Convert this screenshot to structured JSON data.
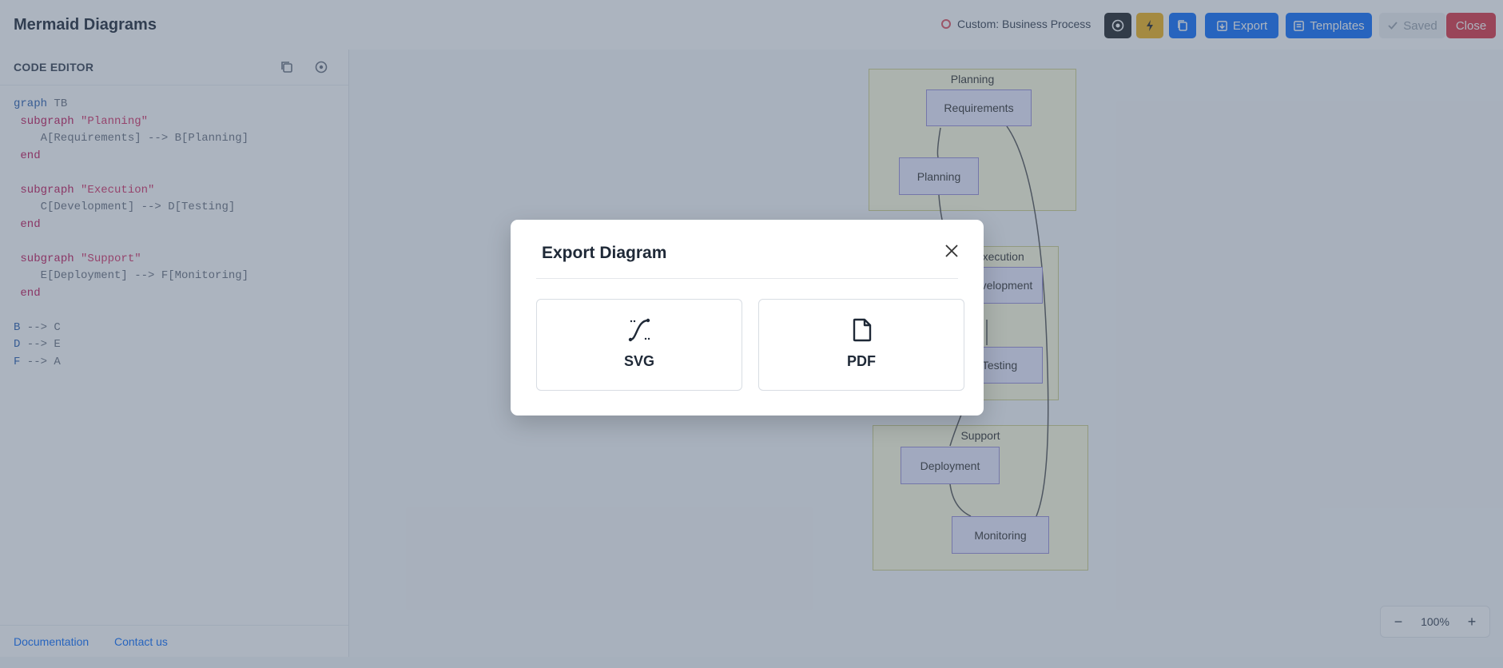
{
  "header": {
    "app_title": "Mermaid Diagrams",
    "process_name": "Custom: Business Process",
    "export_label": "Export",
    "templates_label": "Templates",
    "saved_label": "Saved",
    "close_label": "Close"
  },
  "sidebar": {
    "title": "CODE EDITOR",
    "code": {
      "l1_kw": "graph",
      "l1_rest": " TB",
      "sg1_kw": "subgraph",
      "sg1_name": " \"Planning\"",
      "sg1_body": "    A[Requirements] --> B[Planning]",
      "sg1_end": "end",
      "sg2_kw": "subgraph",
      "sg2_name": " \"Execution\"",
      "sg2_body": "    C[Development] --> D[Testing]",
      "sg2_end": "end",
      "sg3_kw": "subgraph",
      "sg3_name": " \"Support\"",
      "sg3_body": "    E[Deployment] --> F[Monitoring]",
      "sg3_end": "end",
      "e1_a": "B",
      "e1_b": " --> C",
      "e2_a": "D",
      "e2_b": " --> E",
      "e3_a": "F",
      "e3_b": " --> A"
    },
    "links": {
      "documentation": "Documentation",
      "contact": "Contact us"
    }
  },
  "diagram": {
    "subgraphs": {
      "planning": "Planning",
      "execution": "Execution",
      "support": "Support"
    },
    "nodes": {
      "requirements": "Requirements",
      "planning": "Planning",
      "development": "Development",
      "testing": "Testing",
      "deployment": "Deployment",
      "monitoring": "Monitoring"
    }
  },
  "zoom": {
    "level": "100%",
    "minus": "−",
    "plus": "+"
  },
  "modal": {
    "title": "Export Diagram",
    "options": [
      {
        "label": "SVG",
        "icon": "bezier-curve-icon"
      },
      {
        "label": "PDF",
        "icon": "file-icon"
      }
    ]
  },
  "colors": {
    "primary": "#0d6efd",
    "danger": "#dc3545",
    "warning": "#f0b21a",
    "dark": "#212529",
    "overlay": "#465870"
  }
}
